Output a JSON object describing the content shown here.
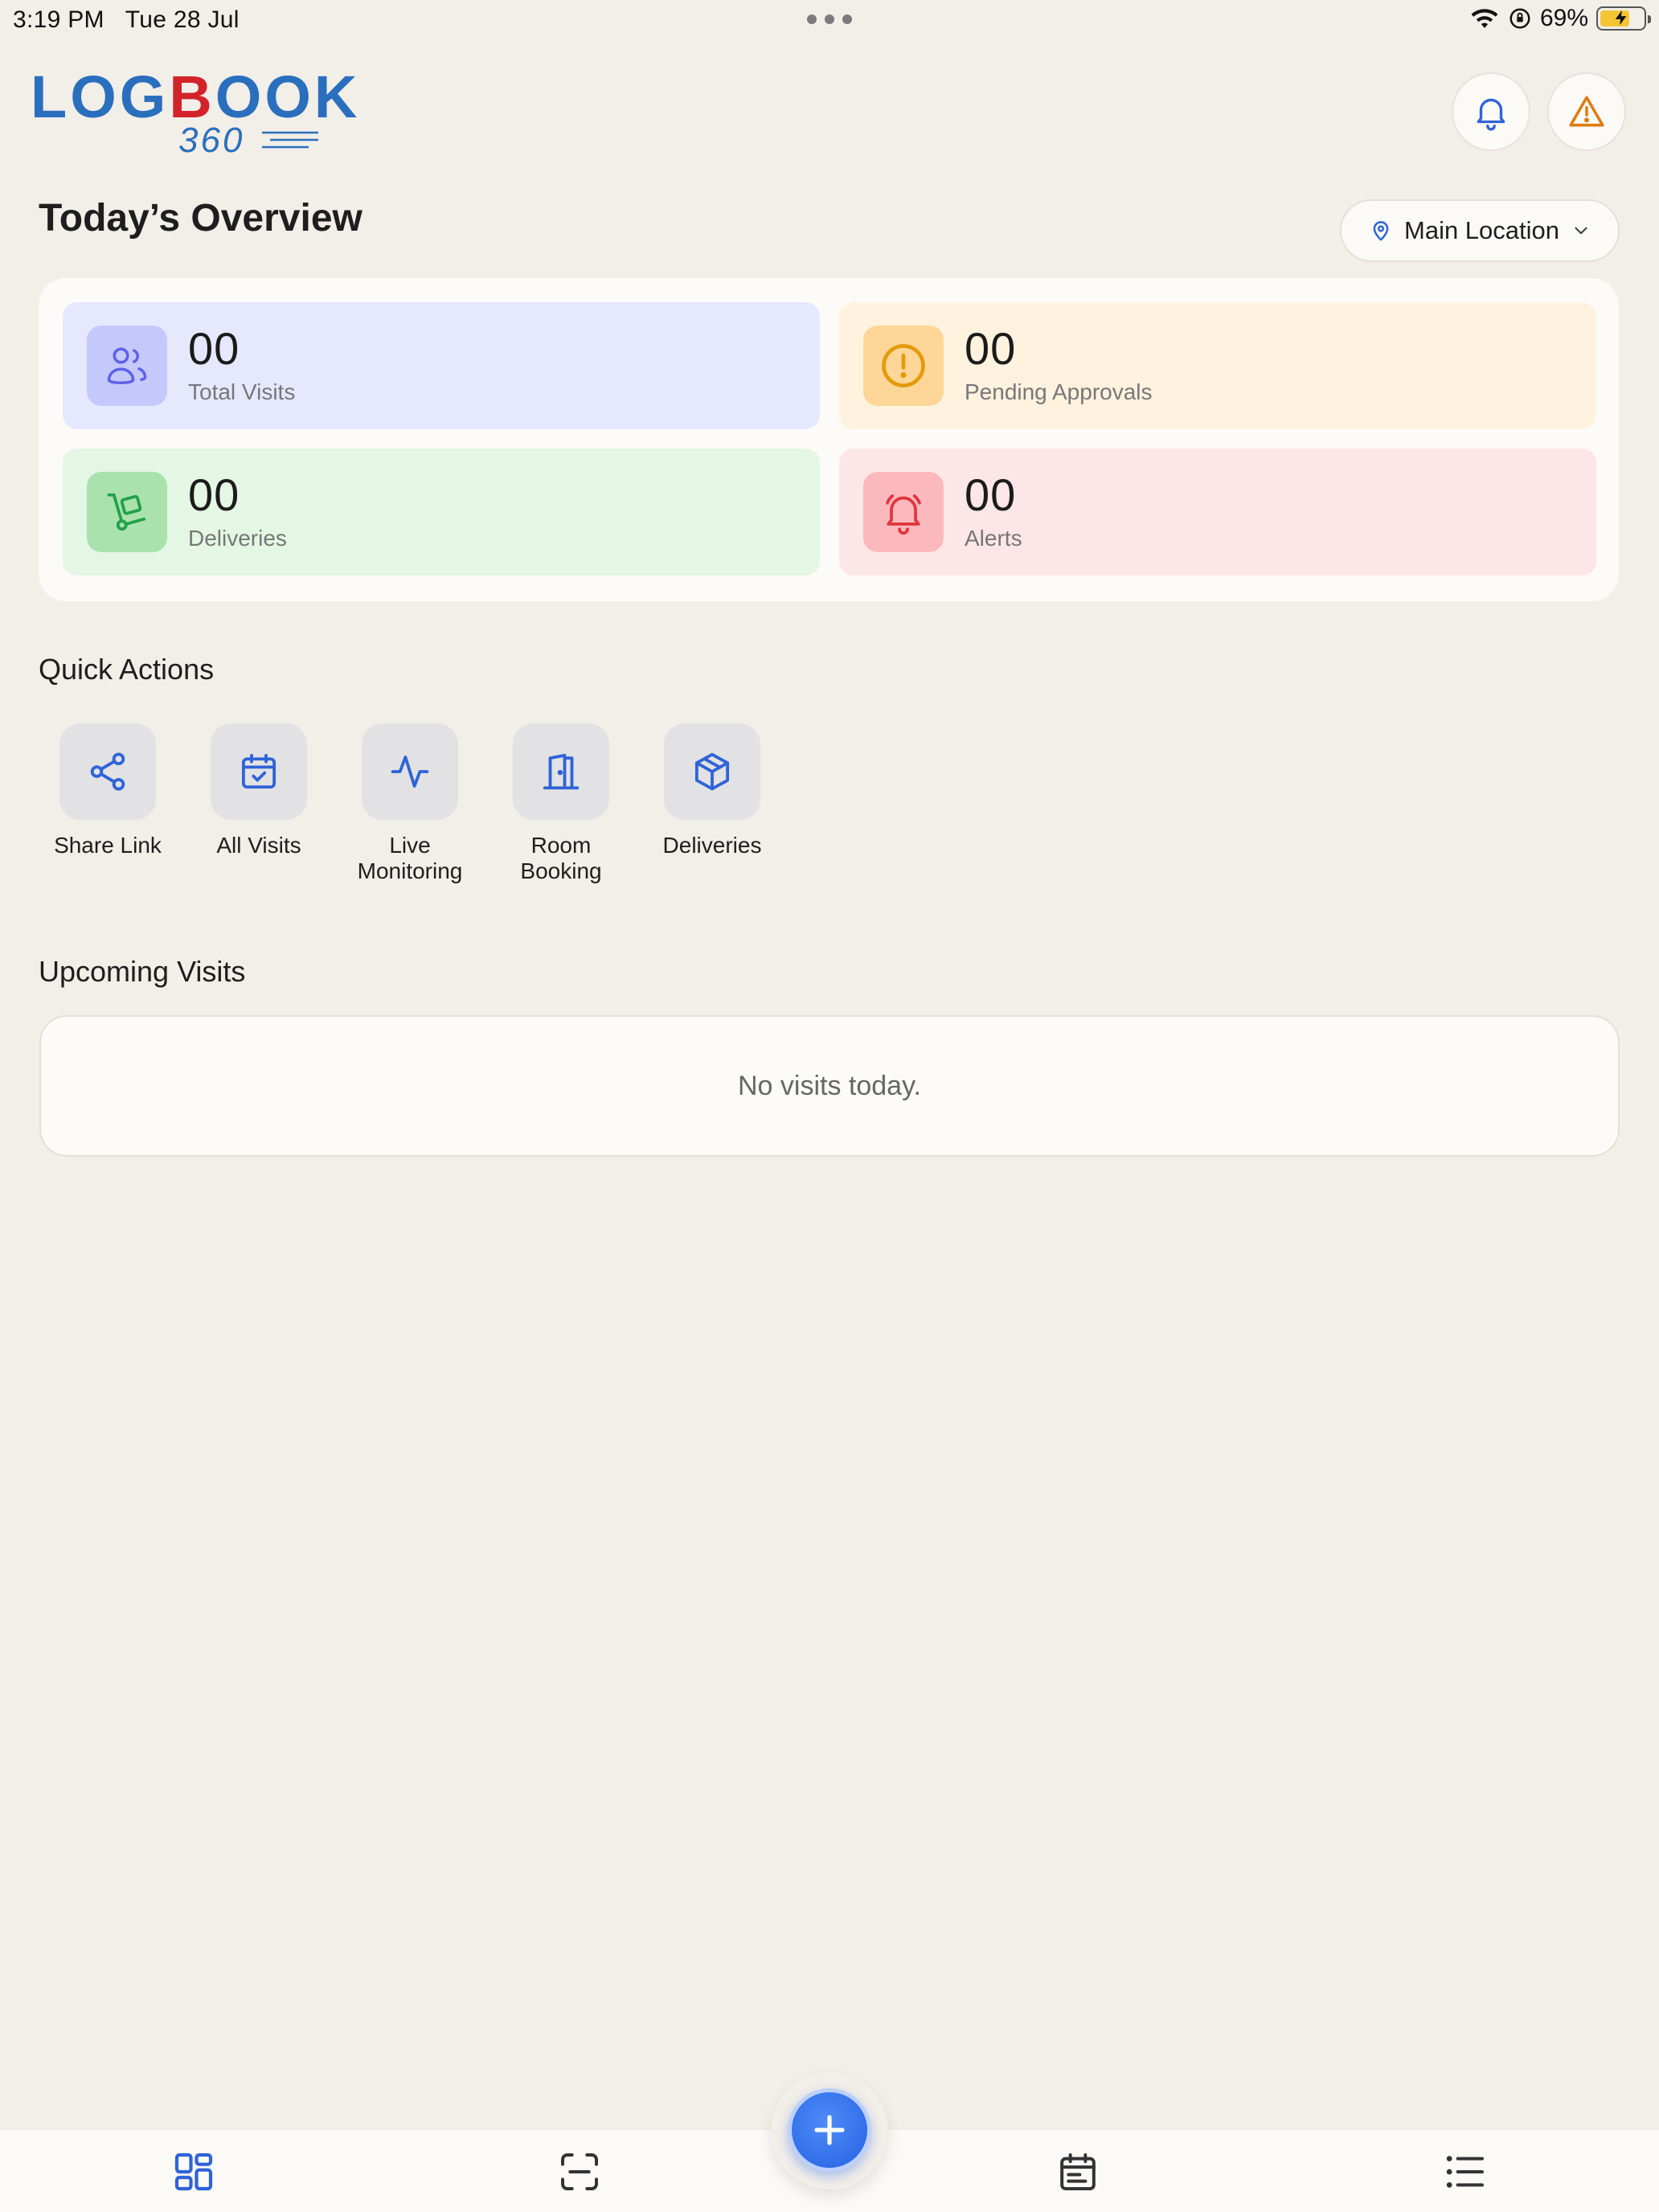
{
  "status_bar": {
    "time": "3:19 PM",
    "date": "Tue 28 Jul",
    "battery": "69%",
    "battery_level": 0.69
  },
  "header": {
    "logo_main_left": "LOG",
    "logo_main_red": "B",
    "logo_main_right": "OOK",
    "logo_sub": "360",
    "notification_icon": "bell-icon",
    "alert_icon": "warning-triangle-icon"
  },
  "overview": {
    "title": "Today’s Overview",
    "location": "Main Location",
    "stats": [
      {
        "value": "00",
        "label": "Total Visits",
        "icon": "users-icon",
        "color": "#6a6ff2"
      },
      {
        "value": "00",
        "label": "Pending Approvals",
        "icon": "exclamation-circle-icon",
        "color": "#e59a0c"
      },
      {
        "value": "00",
        "label": "Deliveries",
        "icon": "hand-truck-icon",
        "color": "#22a04a"
      },
      {
        "value": "00",
        "label": "Alerts",
        "icon": "bell-icon",
        "color": "#e0353d"
      }
    ]
  },
  "quick_actions": {
    "title": "Quick Actions",
    "items": [
      {
        "label": "Share Link",
        "icon": "share-icon"
      },
      {
        "label": "All Visits",
        "icon": "calendar-check-icon"
      },
      {
        "label": "Live\nMonitoring",
        "icon": "activity-icon"
      },
      {
        "label": "Room\nBooking",
        "icon": "door-icon"
      },
      {
        "label": "Deliveries",
        "icon": "package-icon"
      }
    ],
    "icon_color": "#2f63d8"
  },
  "upcoming": {
    "title": "Upcoming Visits",
    "empty_text": "No visits today."
  },
  "bottom_nav": {
    "items": [
      {
        "icon": "dashboard-icon",
        "active": true
      },
      {
        "icon": "scan-icon",
        "active": false
      },
      {
        "icon": "calendar-icon",
        "active": false
      },
      {
        "icon": "list-icon",
        "active": false
      }
    ],
    "fab_icon": "plus-icon",
    "active_color": "#2f63d8"
  },
  "colors": {
    "background": "#f2eee8",
    "brand_blue": "#2a6fbd",
    "brand_red": "#d3232a"
  }
}
